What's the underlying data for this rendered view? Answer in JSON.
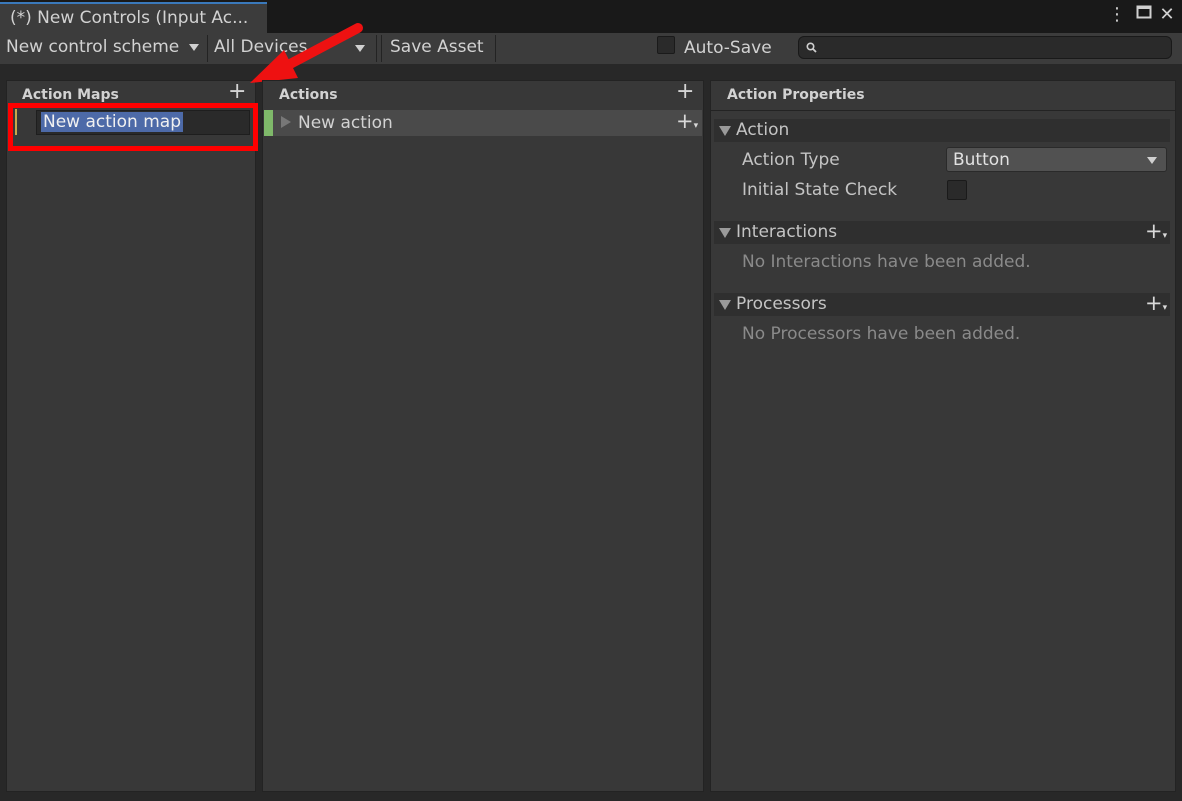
{
  "window": {
    "tab_title": "(*) New Controls (Input Ac...",
    "menu_icon": "⋮",
    "maximize_icon": "🗖",
    "close_icon": "✕"
  },
  "toolbar": {
    "control_scheme": "New control scheme",
    "devices": "All Devices",
    "save_asset": "Save Asset",
    "auto_save": "Auto-Save",
    "search_placeholder": ""
  },
  "action_maps": {
    "header": "Action Maps",
    "add_icon": "+",
    "items": [
      {
        "label": "New action map",
        "editing": true
      }
    ]
  },
  "actions": {
    "header": "Actions",
    "add_icon": "+",
    "items": [
      {
        "label": "New action"
      }
    ]
  },
  "properties": {
    "header": "Action Properties",
    "action_section": "Action",
    "action_type_label": "Action Type",
    "action_type_value": "Button",
    "initial_state_label": "Initial State Check",
    "interactions_section": "Interactions",
    "interactions_empty": "No Interactions have been added.",
    "processors_section": "Processors",
    "processors_empty": "No Processors have been added."
  },
  "annotation": {
    "highlight_color": "#ff0000",
    "arrow_color": "#ee1111"
  },
  "colors": {
    "accent_blue": "#3a79bb",
    "selection": "#4d6aa8",
    "map_marker": "#c9a94a",
    "action_marker": "#7fb96a"
  }
}
